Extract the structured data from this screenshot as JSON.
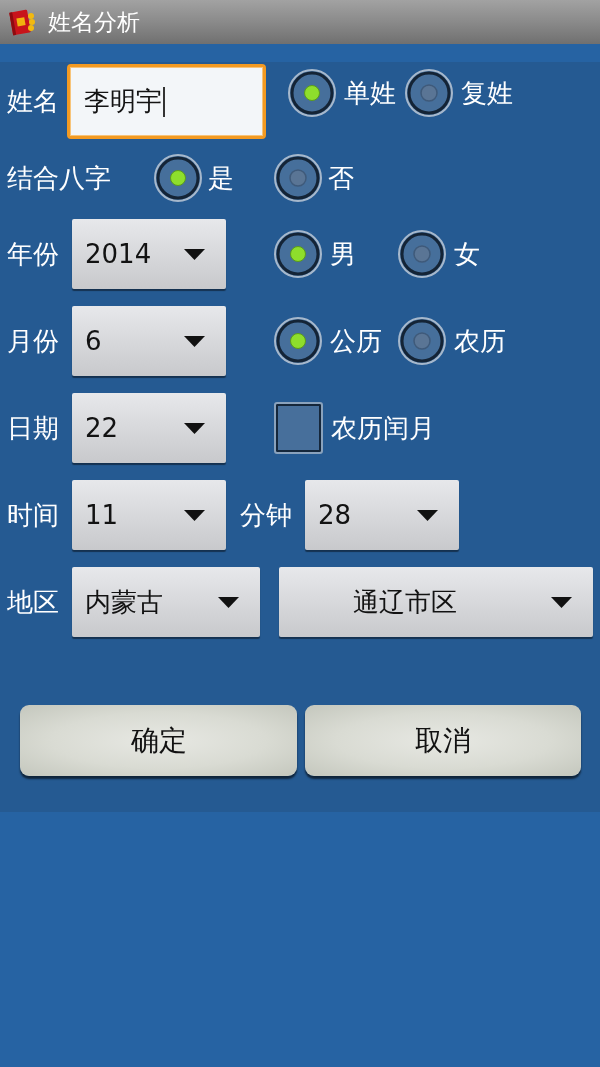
{
  "title_bar": {
    "title": "姓名分析"
  },
  "name_row": {
    "label": "姓名",
    "input": {
      "value": "李明宇",
      "focused": true
    },
    "surname_type": [
      {
        "label": "单姓",
        "selected": true
      },
      {
        "label": "复姓",
        "selected": false
      }
    ]
  },
  "bazi_row": {
    "label": "结合八字",
    "options": [
      {
        "label": "是",
        "selected": true
      },
      {
        "label": "否",
        "selected": false
      }
    ]
  },
  "year_row": {
    "label": "年份",
    "value": "2014",
    "gender": [
      {
        "label": "男",
        "selected": true
      },
      {
        "label": "女",
        "selected": false
      }
    ]
  },
  "month_row": {
    "label": "月份",
    "value": "6",
    "calendar": [
      {
        "label": "公历",
        "selected": true
      },
      {
        "label": "农历",
        "selected": false
      }
    ]
  },
  "day_row": {
    "label": "日期",
    "value": "22",
    "leap_month": {
      "label": "农历闰月",
      "checked": false
    }
  },
  "time_row": {
    "label": "时间",
    "value": "11",
    "minute_label": "分钟",
    "minute_value": "28"
  },
  "region_row": {
    "label": "地区",
    "province": "内蒙古",
    "city": "通辽市区"
  },
  "buttons": [
    {
      "label": "确定"
    },
    {
      "label": "取消"
    }
  ]
}
